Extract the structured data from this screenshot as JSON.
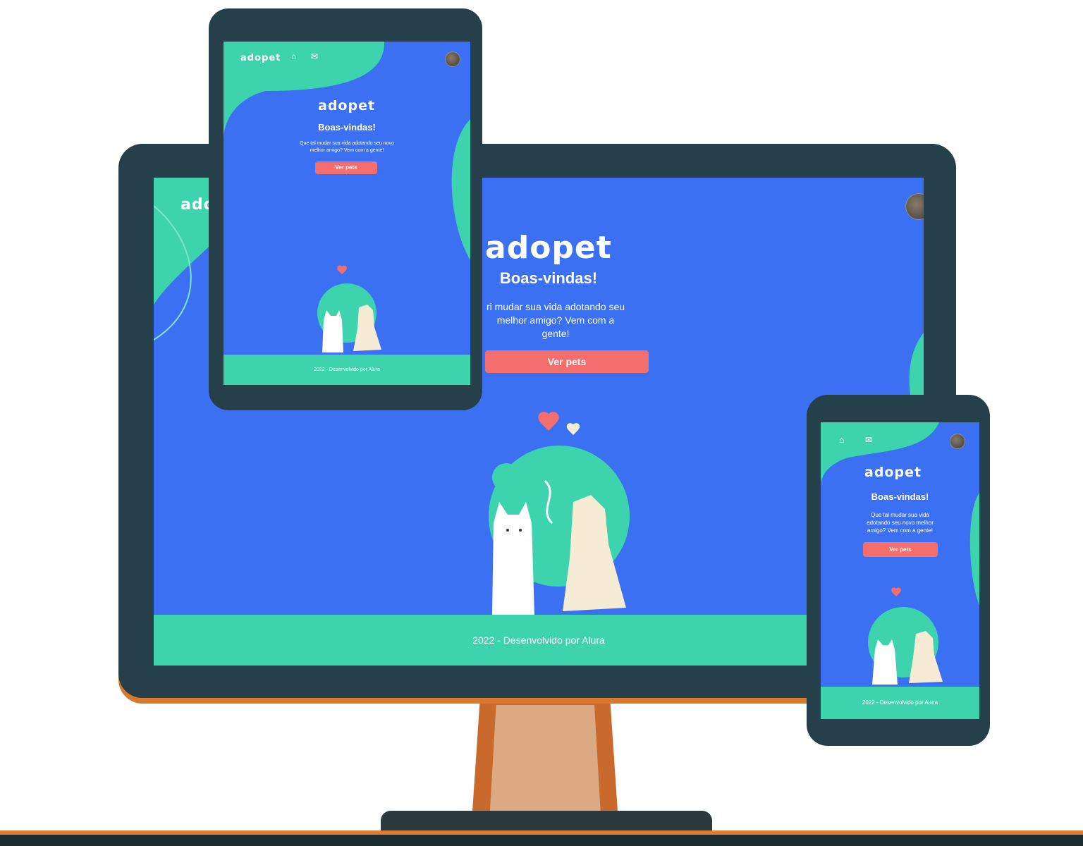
{
  "brand": {
    "name": "adopet"
  },
  "hero": {
    "title": "Boas-vindas!",
    "desktop_text_line1": "ri mudar sua vida adotando seu",
    "desktop_text_line2": "melhor amigo? Vem com a",
    "desktop_text_line3": "gente!",
    "tablet_text_line1": "Que tal mudar sua vida adotando seu novo",
    "tablet_text_line2": "melhor amigo? Vem com a gente!",
    "phone_text_line1": "Que tal mudar sua vida",
    "phone_text_line2": "adotando seu novo melhor",
    "phone_text_line3": "amigo? Vem com a gente!",
    "button_label": "Ver pets"
  },
  "footer": {
    "text": "2022 - Desenvolvido por Alura"
  },
  "nav": {
    "home_icon": "home-icon",
    "mail_icon": "mail-icon"
  },
  "colors": {
    "primary": "#3b70f2",
    "accent": "#3dd4ad",
    "button": "#f46e6e",
    "frame": "#253f4b"
  }
}
